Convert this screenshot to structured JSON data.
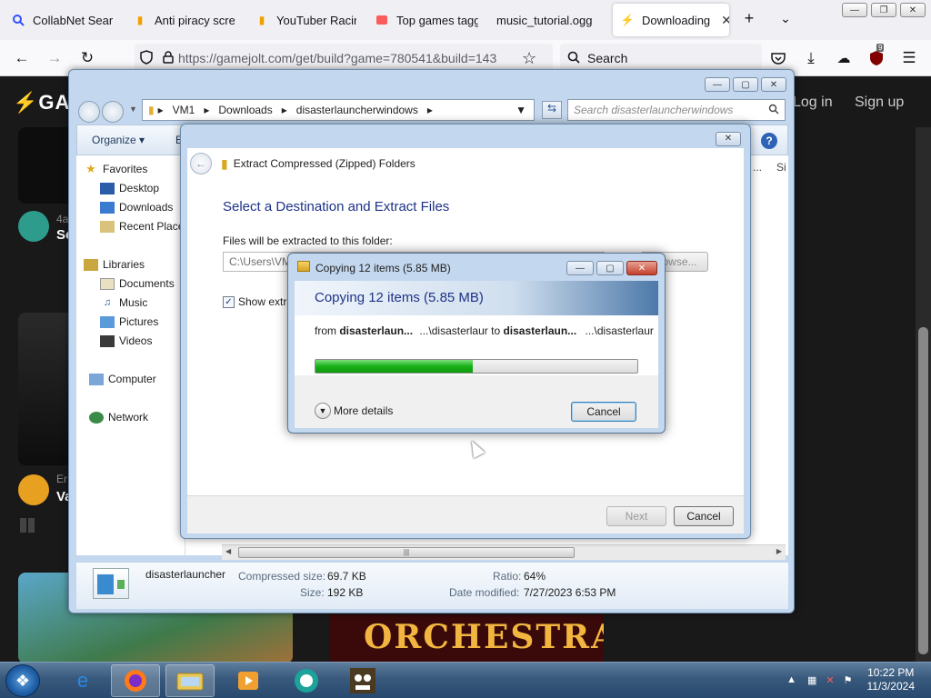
{
  "browser": {
    "tabs": [
      {
        "label": "CollabNet SearXN",
        "icon": "searx-icon"
      },
      {
        "label": "Anti piracy scree",
        "icon": "document-icon"
      },
      {
        "label": "YouTuber Racing",
        "icon": "document-icon"
      },
      {
        "label": "Top games tagge",
        "icon": "itchio-icon"
      },
      {
        "label": "music_tutorial.ogg",
        "icon": ""
      },
      {
        "label": "Downloading",
        "icon": "gamejolt-icon"
      }
    ],
    "url": "https://gamejolt.com/get/build?game=780541&build=143",
    "search_label": "Search",
    "extension_badge": "9"
  },
  "webpage": {
    "logo": "GAI",
    "login": "Log in",
    "signup": "Sign up",
    "user1_prefix": "4a",
    "user1_name": "Se",
    "user2_prefix": "Er",
    "user2_name": "Va",
    "banner_text": "ORCHESTRA",
    "right_col1": "...",
    "right_col2": "Si"
  },
  "explorer": {
    "breadcrumb": [
      "VM1",
      "Downloads",
      "disasterlauncherwindows"
    ],
    "search_placeholder": "Search disasterlauncherwindows",
    "organize": "Organize",
    "cmd_extra": "E",
    "nav": {
      "favorites": "Favorites",
      "desktop": "Desktop",
      "downloads": "Downloads",
      "recent": "Recent Place",
      "libraries": "Libraries",
      "documents": "Documents",
      "music": "Music",
      "pictures": "Pictures",
      "videos": "Videos",
      "computer": "Computer",
      "network": "Network"
    },
    "details": {
      "name": "disasterlauncher",
      "compressed_label": "Compressed size:",
      "compressed_value": "69.7 KB",
      "size_label": "Size:",
      "size_value": "192 KB",
      "ratio_label": "Ratio:",
      "ratio_value": "64%",
      "modified_label": "Date modified:",
      "modified_value": "7/27/2023 6:53 PM"
    }
  },
  "wizard": {
    "title": "Extract Compressed (Zipped) Folders",
    "heading": "Select a Destination and Extract Files",
    "folder_label": "Files will be extracted to this folder:",
    "path_value": "C:\\Users\\VM",
    "browse": "Browse...",
    "show_label": "Show extra",
    "next": "Next",
    "cancel": "Cancel"
  },
  "copy_dialog": {
    "title": "Copying 12 items (5.85 MB)",
    "heading": "Copying 12 items (5.85 MB)",
    "from_word": "from",
    "from_name": "disasterlaun...",
    "from_path": "...\\disasterlaur",
    "to_word": "to",
    "to_name": "disasterlaun...",
    "to_path": "...\\disasterlaur",
    "progress": 0.49,
    "more_details": "More details",
    "cancel": "Cancel"
  },
  "taskbar": {
    "time": "10:22 PM",
    "date": "11/3/2024"
  },
  "colors": {
    "progress_green": "#18b018",
    "heading_blue": "#1e3287",
    "window_frame": "#c3d7ee"
  }
}
